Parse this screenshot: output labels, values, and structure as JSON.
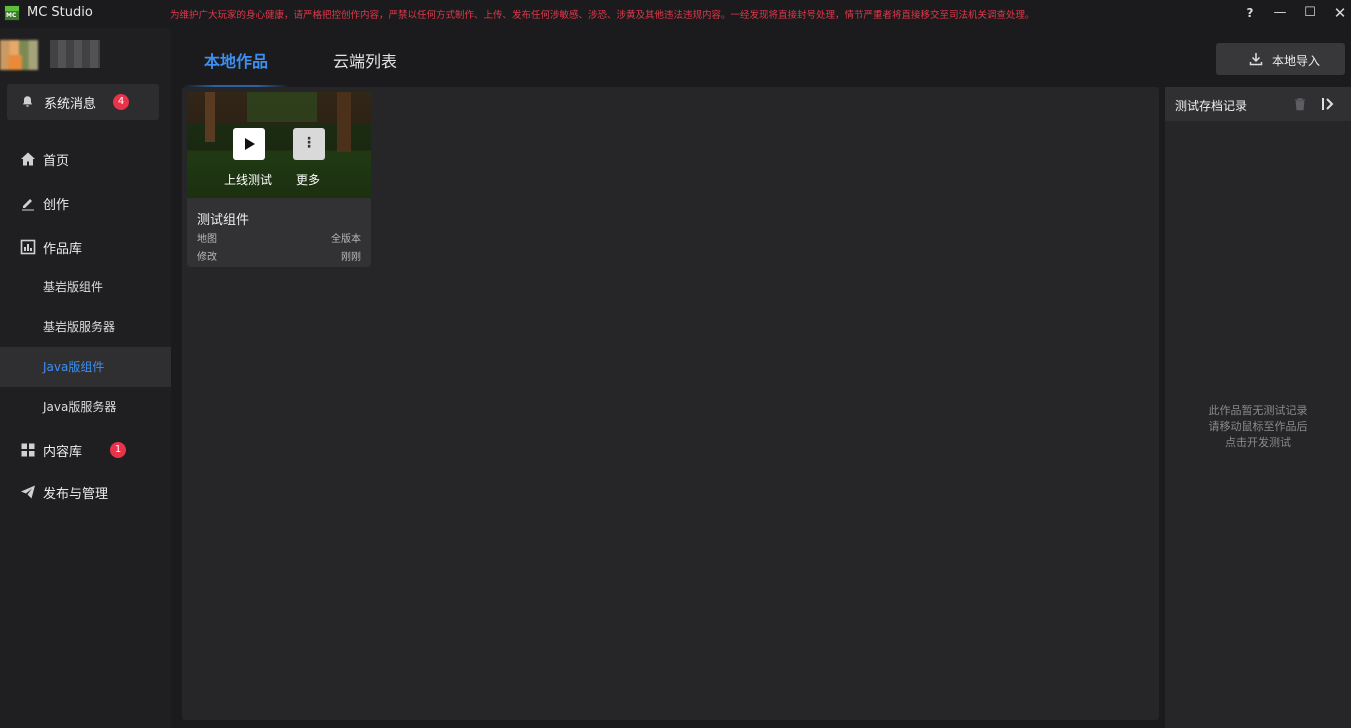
{
  "titlebar": {
    "app_name": "MC Studio",
    "warning": "为维护广大玩家的身心健康，请严格把控创作内容，严禁以任何方式制作、上传、发布任何涉敏感、涉恐、涉黄及其他违法违规内容。一经发现将直接封号处理，情节严重者将直接移交至司法机关调查处理。",
    "help_label": "?",
    "minimize_label": "—",
    "maximize_label": "☐",
    "close_label": "✕"
  },
  "sidebar": {
    "notifications": {
      "label": "系统消息",
      "count": "4"
    },
    "items": [
      {
        "label": "首页",
        "icon": "home-icon"
      },
      {
        "label": "创作",
        "icon": "edit-icon"
      },
      {
        "label": "作品库",
        "icon": "library-icon"
      },
      {
        "label": "基岩版组件"
      },
      {
        "label": "基岩版服务器"
      },
      {
        "label": "Java版组件",
        "active": true
      },
      {
        "label": "Java版服务器"
      },
      {
        "label": "内容库",
        "icon": "grid-icon",
        "badge": "1"
      },
      {
        "label": "发布与管理",
        "icon": "send-icon"
      }
    ]
  },
  "tabs": {
    "local": "本地作品",
    "cloud": "云端列表"
  },
  "toolbar": {
    "import_label": "本地导入"
  },
  "card": {
    "play_label": "上线测试",
    "more_label": "更多",
    "more_glyph": "⋮",
    "title": "测试组件",
    "type": "地图",
    "version": "全版本",
    "modified_label": "修改",
    "modified_time": "刚刚"
  },
  "right_panel": {
    "title": "测试存档记录",
    "empty_line1": "此作品暂无测试记录",
    "empty_line2": "请移动鼠标至作品后",
    "empty_line3": "点击开发测试"
  },
  "colors": {
    "accent": "#3d8ef0",
    "badge": "#e8334a",
    "warning": "#e0384a"
  }
}
